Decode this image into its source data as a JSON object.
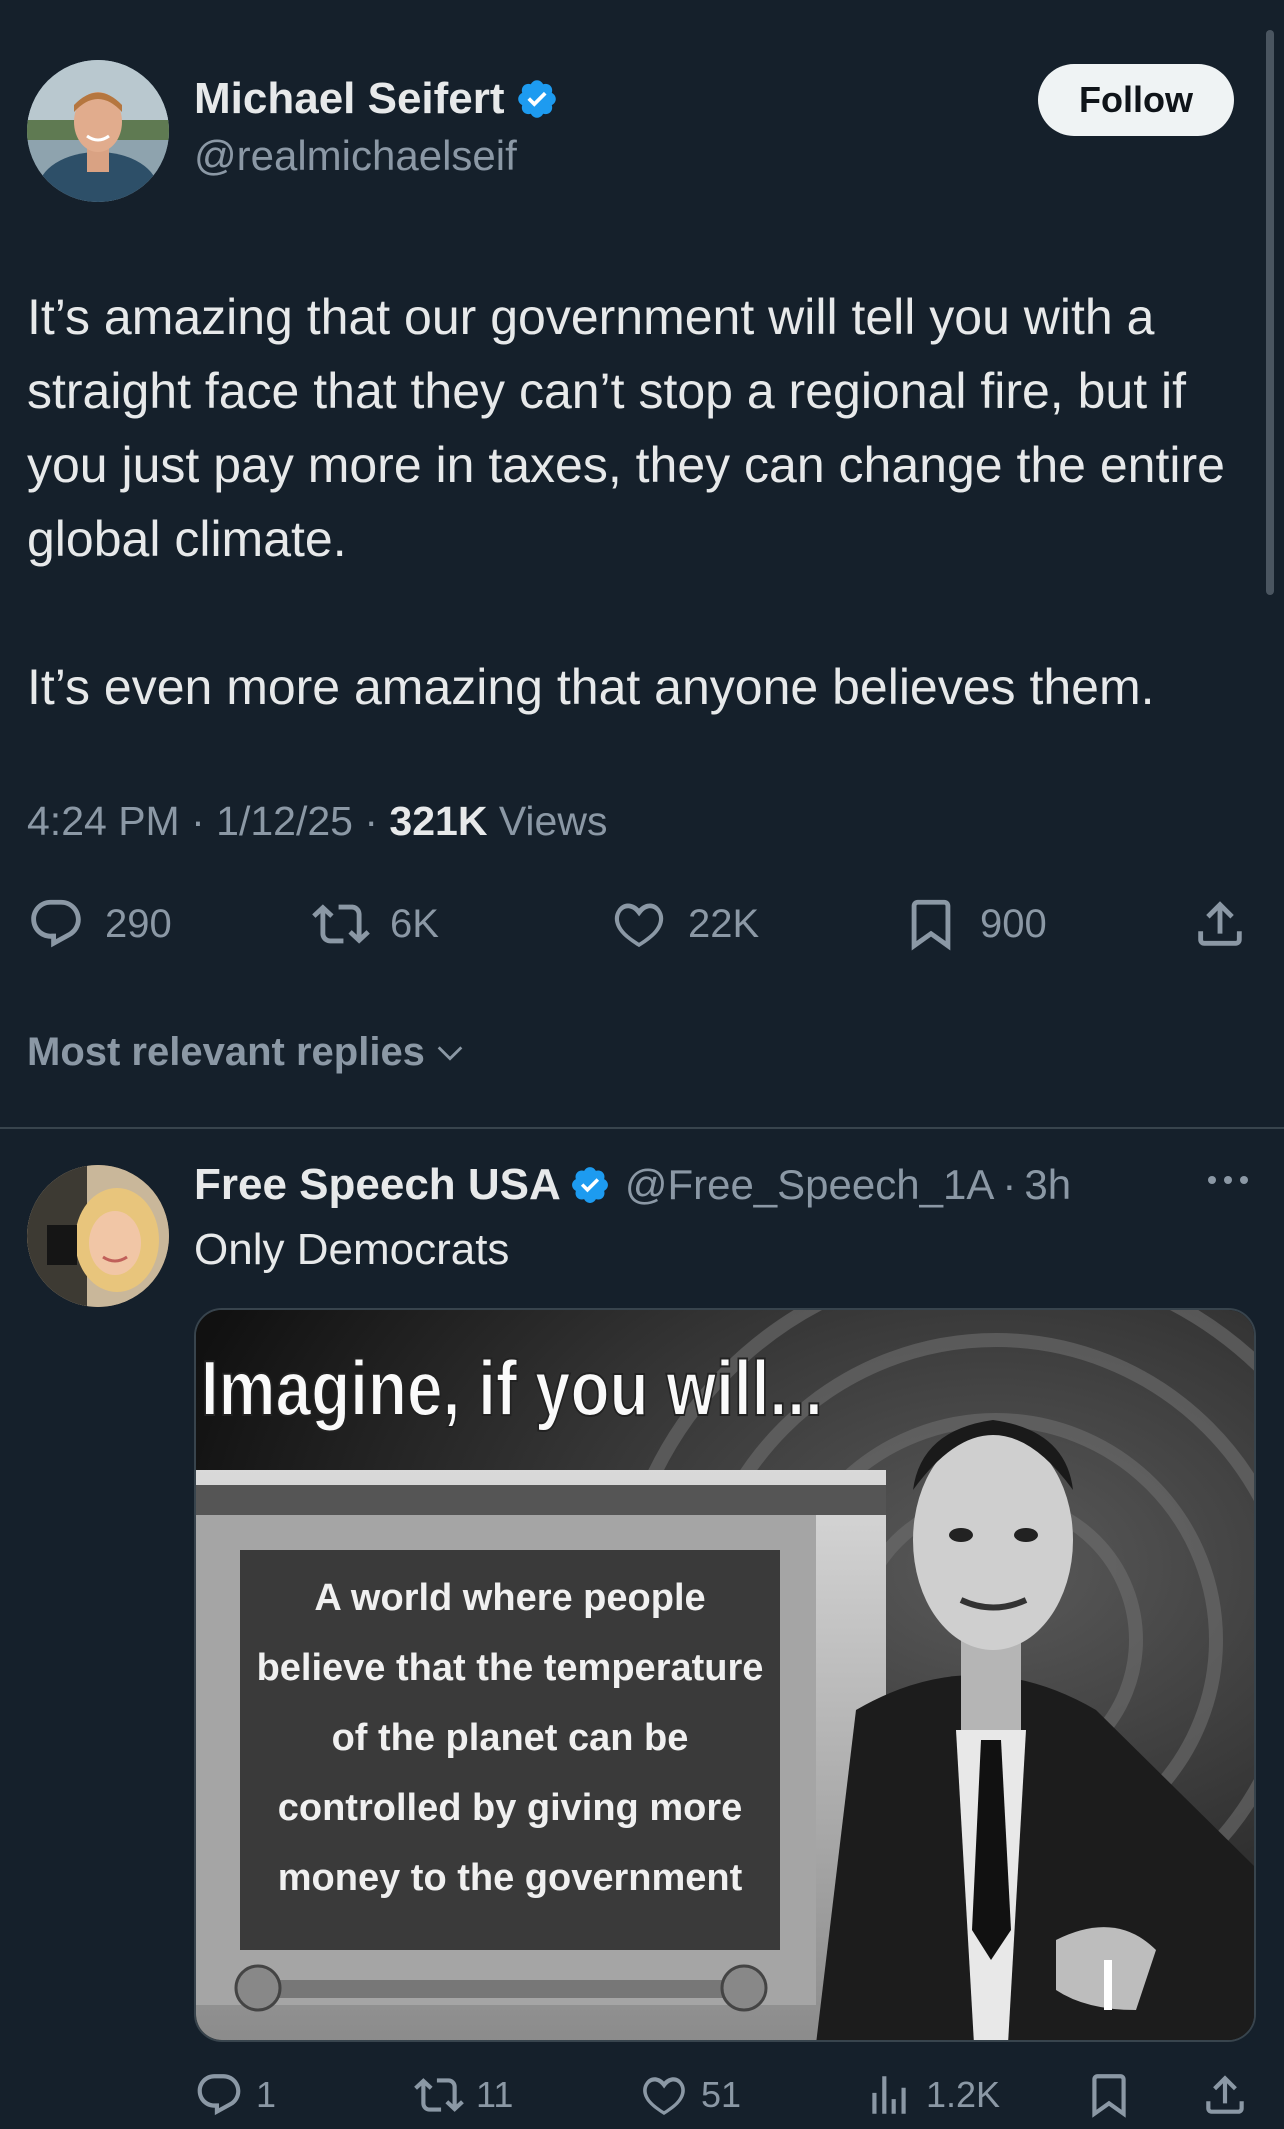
{
  "main_tweet": {
    "author_name": "Michael Seifert",
    "author_handle": "@realmichaelseif",
    "follow_label": "Follow",
    "text_p1": "It’s amazing that our government will tell you with a straight face that they can’t stop a regional fire, but if you just pay more in taxes, they can change the entire global climate.",
    "text_p2": "It’s even more amazing that anyone believes them.",
    "time": "4:24 PM",
    "date": "1/12/25",
    "views_count": "321K",
    "views_label": "Views",
    "stats": {
      "replies": "290",
      "reposts": "6K",
      "likes": "22K",
      "bookmarks": "900"
    }
  },
  "replies_sort_label": "Most relevant replies",
  "reply": {
    "author_name": "Free Speech USA",
    "author_handle": "@Free_Speech_1A",
    "time": "3h",
    "text": "Only Democrats",
    "image": {
      "headline": "Imagine, if you will...",
      "caption_lines": [
        "A world where people",
        "believe that the temperature",
        "of the planet can be",
        "controlled by giving more",
        "money to the government"
      ]
    },
    "stats": {
      "replies": "1",
      "reposts": "11",
      "likes": "51",
      "views": "1.2K"
    }
  },
  "colors": {
    "background": "#15202b",
    "text": "#e7e9ea",
    "muted": "#8b98a5",
    "verified": "#1d9bf0",
    "divider": "#38444d"
  }
}
